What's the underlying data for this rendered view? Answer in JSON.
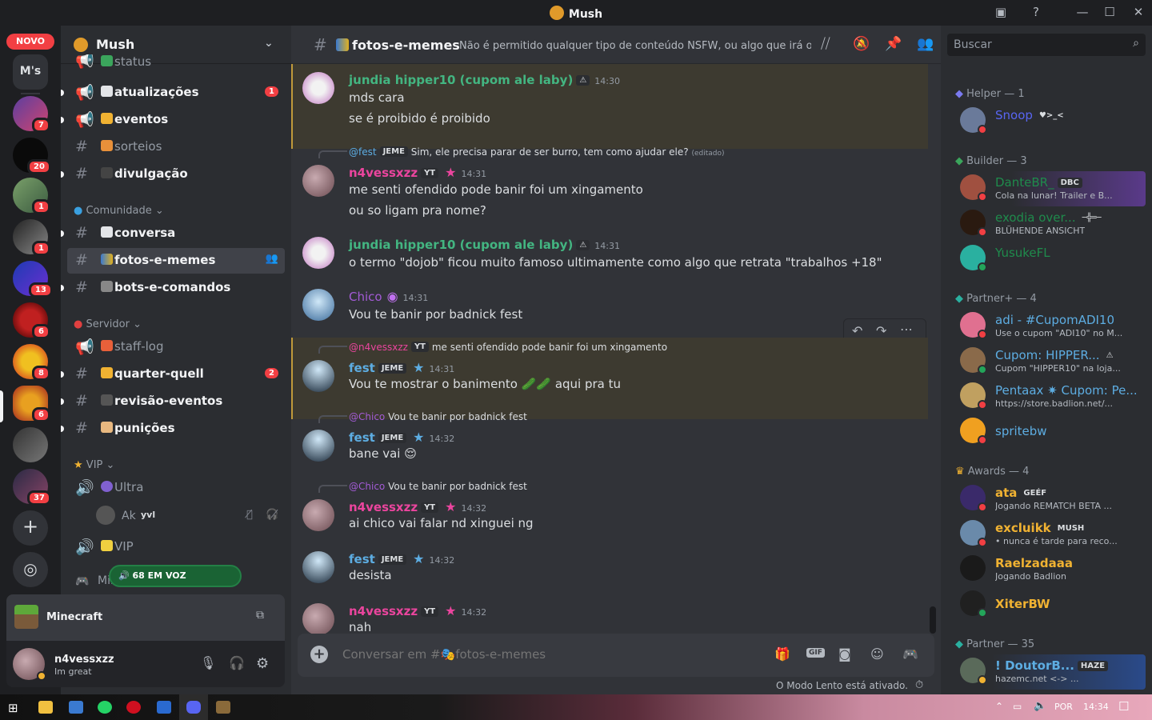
{
  "window": {
    "title": "Mush",
    "new_badge": "NOVO",
    "ms_label": "M's"
  },
  "guilds": {
    "badges": [
      "7",
      "20",
      "1",
      "1",
      "13",
      "6",
      "8",
      "6",
      "37"
    ]
  },
  "server": {
    "name": "Mush"
  },
  "channels": {
    "status": "status",
    "atualizacoes": "atualizações",
    "atualizacoes_badge": "1",
    "eventos": "eventos",
    "sorteios": "sorteios",
    "divulgacao": "divulgação",
    "cat_comunidade": "Comunidade",
    "conversa": "conversa",
    "fotos": "fotos-e-memes",
    "bots": "bots-e-comandos",
    "cat_servidor": "Servidor",
    "staff_log": "staff-log",
    "quarter": "quarter-quell",
    "quarter_badge": "2",
    "revisao": "revisão-eventos",
    "punicoes": "punições",
    "cat_vip": "VIP",
    "ultra": "Ultra",
    "voice_user": "Ak",
    "voice_user_tag": "yvl",
    "vip": "VIP",
    "mine": "Mine",
    "voice_pill": "68 EM VOZ"
  },
  "activity": {
    "game": "Minecraft"
  },
  "user": {
    "name": "n4vessxzz",
    "status": "Im great"
  },
  "chat": {
    "channel_name": "fotos-e-memes",
    "topic": "Não é permitido qualquer tipo de conteúdo NSFW, ou algo que irá ofen...",
    "placeholder": "Conversar em #🎭fotos-e-memes",
    "slowmode": "O Modo Lento está ativado.",
    "messages": [
      {
        "author": "jundia hipper10 (cupom ale laby)",
        "tag": "⚠",
        "time": "14:30",
        "lines": [
          "mds cara",
          "se é proibido é proibido"
        ]
      },
      {
        "reply_to": "@fest",
        "reply_tag": "JEME",
        "reply_text": "Sim, ele precisa parar de ser burro, tem como ajudar ele?",
        "reply_edited": "(editado)",
        "author": "n4vessxzz",
        "tag": "YT",
        "time": "14:31",
        "lines": [
          "me senti ofendido pode banir foi um xingamento",
          "ou so ligam pra nome?"
        ]
      },
      {
        "author": "jundia hipper10 (cupom ale laby)",
        "tag": "⚠",
        "time": "14:31",
        "lines": [
          "o termo \"dojob\" ficou muito famoso ultimamente como algo que retrata \"trabalhos +18\""
        ]
      },
      {
        "author": "Chico",
        "time": "14:31",
        "lines": [
          "Vou te banir por badnick fest"
        ]
      },
      {
        "reply_to": "@n4vessxzz",
        "reply_tag": "YT",
        "reply_text": "me senti ofendido pode banir foi um xingamento",
        "author": "fest",
        "tag": "JEME",
        "time": "14:31",
        "lines": [
          "Vou te mostrar o banimento 🥒🥒 aqui pra tu"
        ]
      },
      {
        "reply_to": "@Chico",
        "reply_text": "Vou te banir por badnick fest",
        "author": "fest",
        "tag": "JEME",
        "time": "14:32",
        "lines": [
          "bane vai 😌"
        ]
      },
      {
        "reply_to": "@Chico",
        "reply_text": "Vou te banir por badnick fest",
        "author": "n4vessxzz",
        "tag": "YT",
        "time": "14:32",
        "lines": [
          "ai chico vai falar nd xinguei ng"
        ]
      },
      {
        "author": "fest",
        "tag": "JEME",
        "time": "14:32",
        "lines": [
          "desista"
        ]
      },
      {
        "author": "n4vessxzz",
        "tag": "YT",
        "time": "14:32",
        "lines": [
          "nah"
        ]
      }
    ]
  },
  "members": {
    "search_placeholder": "Buscar",
    "groups": [
      {
        "label": "Helper — 1",
        "items": [
          {
            "name": "Snoop",
            "tag": "♥>_<",
            "sub": ""
          }
        ]
      },
      {
        "label": "Builder — 3",
        "items": [
          {
            "name": "DanteBR_",
            "tag": "DBC",
            "sub": "Cola na lunar! Trailer e B..."
          },
          {
            "name": "exodia over...",
            "tag": "─╬═─",
            "sub": "BLÜHENDE ANSICHT"
          },
          {
            "name": "YusukeFL",
            "tag": "",
            "sub": ""
          }
        ]
      },
      {
        "label": "Partner+ — 4",
        "items": [
          {
            "name": "adi - #CupomADI10",
            "tag": "",
            "sub": "Use o cupom \"ADI10\" no M..."
          },
          {
            "name": "Cupom: HIPPER...",
            "tag": "⚠",
            "sub": "Cupom \"HIPPER10\" na loja..."
          },
          {
            "name": "Pentaax ✷ Cupom: Pe...",
            "tag": "",
            "sub": "https://store.badlion.net/..."
          },
          {
            "name": "spritebw",
            "tag": "",
            "sub": ""
          }
        ]
      },
      {
        "label": "Awards — 4",
        "items": [
          {
            "name": "ata",
            "tag": "GEÉF",
            "sub": "Jogando REMATCH BETA ..."
          },
          {
            "name": "excluikk",
            "tag": "MUSH",
            "sub": "• nunca é tarde para reco..."
          },
          {
            "name": "Raelzadaaa",
            "tag": "",
            "sub": "Jogando Badlion"
          },
          {
            "name": "XiterBW",
            "tag": "",
            "sub": ""
          }
        ]
      },
      {
        "label": "Partner — 35",
        "items": [
          {
            "name": "! DoutorB...",
            "tag": "HAZE",
            "sub": "hazemc.net <-> ..."
          }
        ]
      }
    ]
  },
  "taskbar": {
    "lang": "POR",
    "clock": "14:34"
  },
  "colors": {
    "green_name": "#43b581",
    "pink_name": "#eb459e",
    "blue_name": "#5dade2",
    "chico": "#a35bd6",
    "yellow": "#f0b232"
  }
}
